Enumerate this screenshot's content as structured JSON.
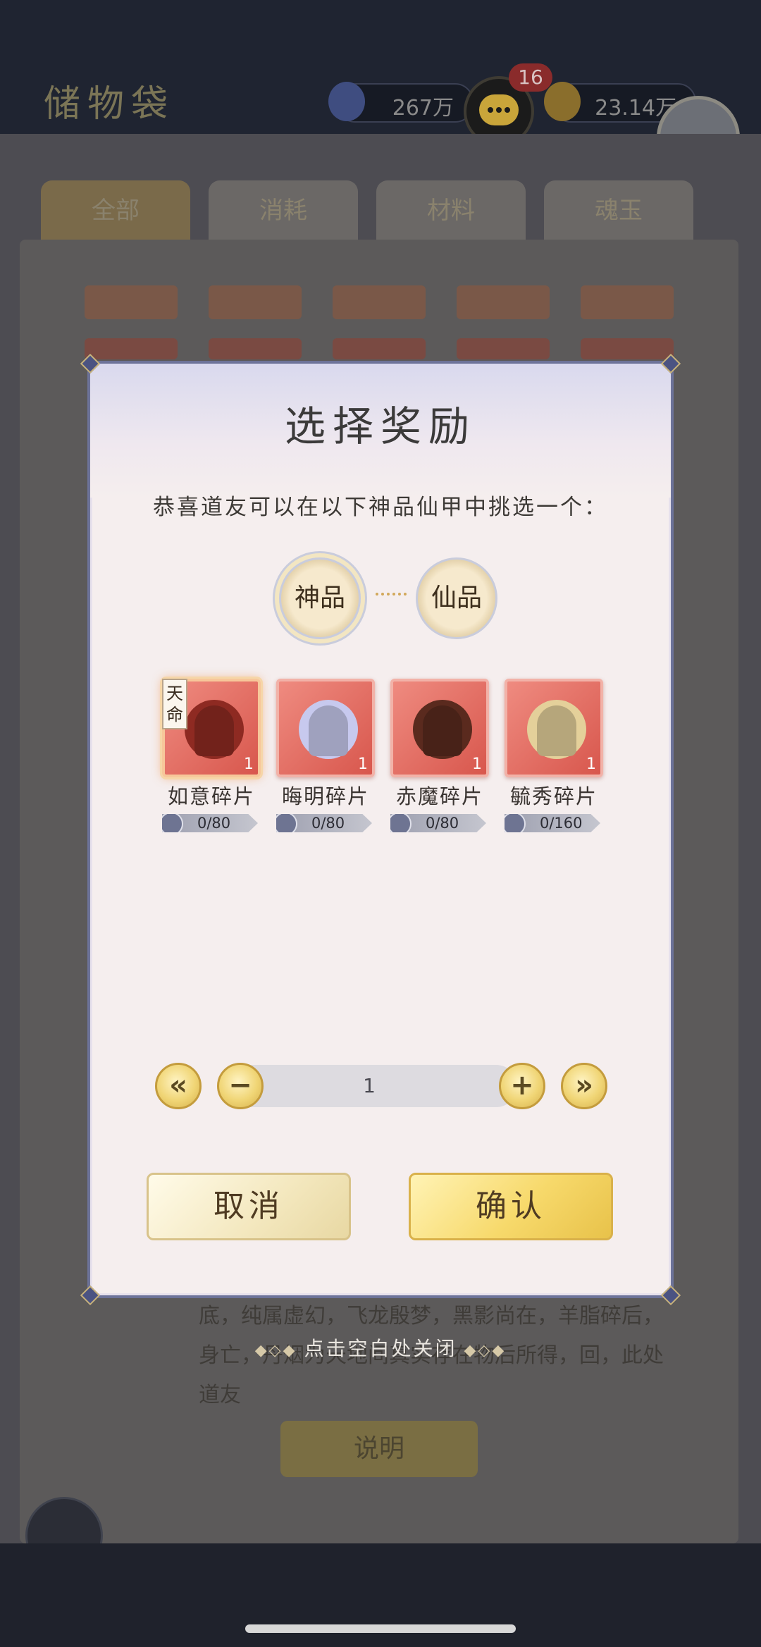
{
  "background": {
    "title": "储物袋",
    "resource_1": "267万",
    "resource_2": "23.14万",
    "chat_badge": "16",
    "tabs": [
      "全部",
      "消耗",
      "材料",
      "魂玉"
    ],
    "description": "底，纯属虚幻，飞龙殷梦，黑影尚在，羊脂碎后，身亡，丹烟为天地间真实存在物后所得，回，此处道友",
    "button_label": "说明"
  },
  "dialog": {
    "title": "选择奖励",
    "subtitle": "恭喜道友可以在以下神品仙甲中挑选一个：",
    "grades": [
      {
        "label": "神品",
        "active": true
      },
      {
        "label": "仙品",
        "active": false
      }
    ],
    "rewards": [
      {
        "name": "如意碎片",
        "qty": "1",
        "progress": "0/80",
        "tag": "天命",
        "selected": true,
        "robe_color": "#8e2a22"
      },
      {
        "name": "晦明碎片",
        "qty": "1",
        "progress": "0/80",
        "tag": "",
        "selected": false,
        "robe_color": "#c7c9ee"
      },
      {
        "name": "赤魔碎片",
        "qty": "1",
        "progress": "0/80",
        "tag": "",
        "selected": false,
        "robe_color": "#5a2a1e"
      },
      {
        "name": "毓秀碎片",
        "qty": "1",
        "progress": "0/160",
        "tag": "",
        "selected": false,
        "robe_color": "#e4d09a"
      }
    ],
    "quantity": {
      "value": "1",
      "min_label": "«",
      "minus_label": "−",
      "plus_label": "+",
      "max_label": "»"
    },
    "cancel_label": "取消",
    "confirm_label": "确认"
  },
  "close_hint": "点击空白处关闭",
  "colors": {
    "dialog_bg": "#f5eeee",
    "dialog_border": "#6d7399",
    "card_red": "#d8574d",
    "gold": "#f0d575"
  }
}
